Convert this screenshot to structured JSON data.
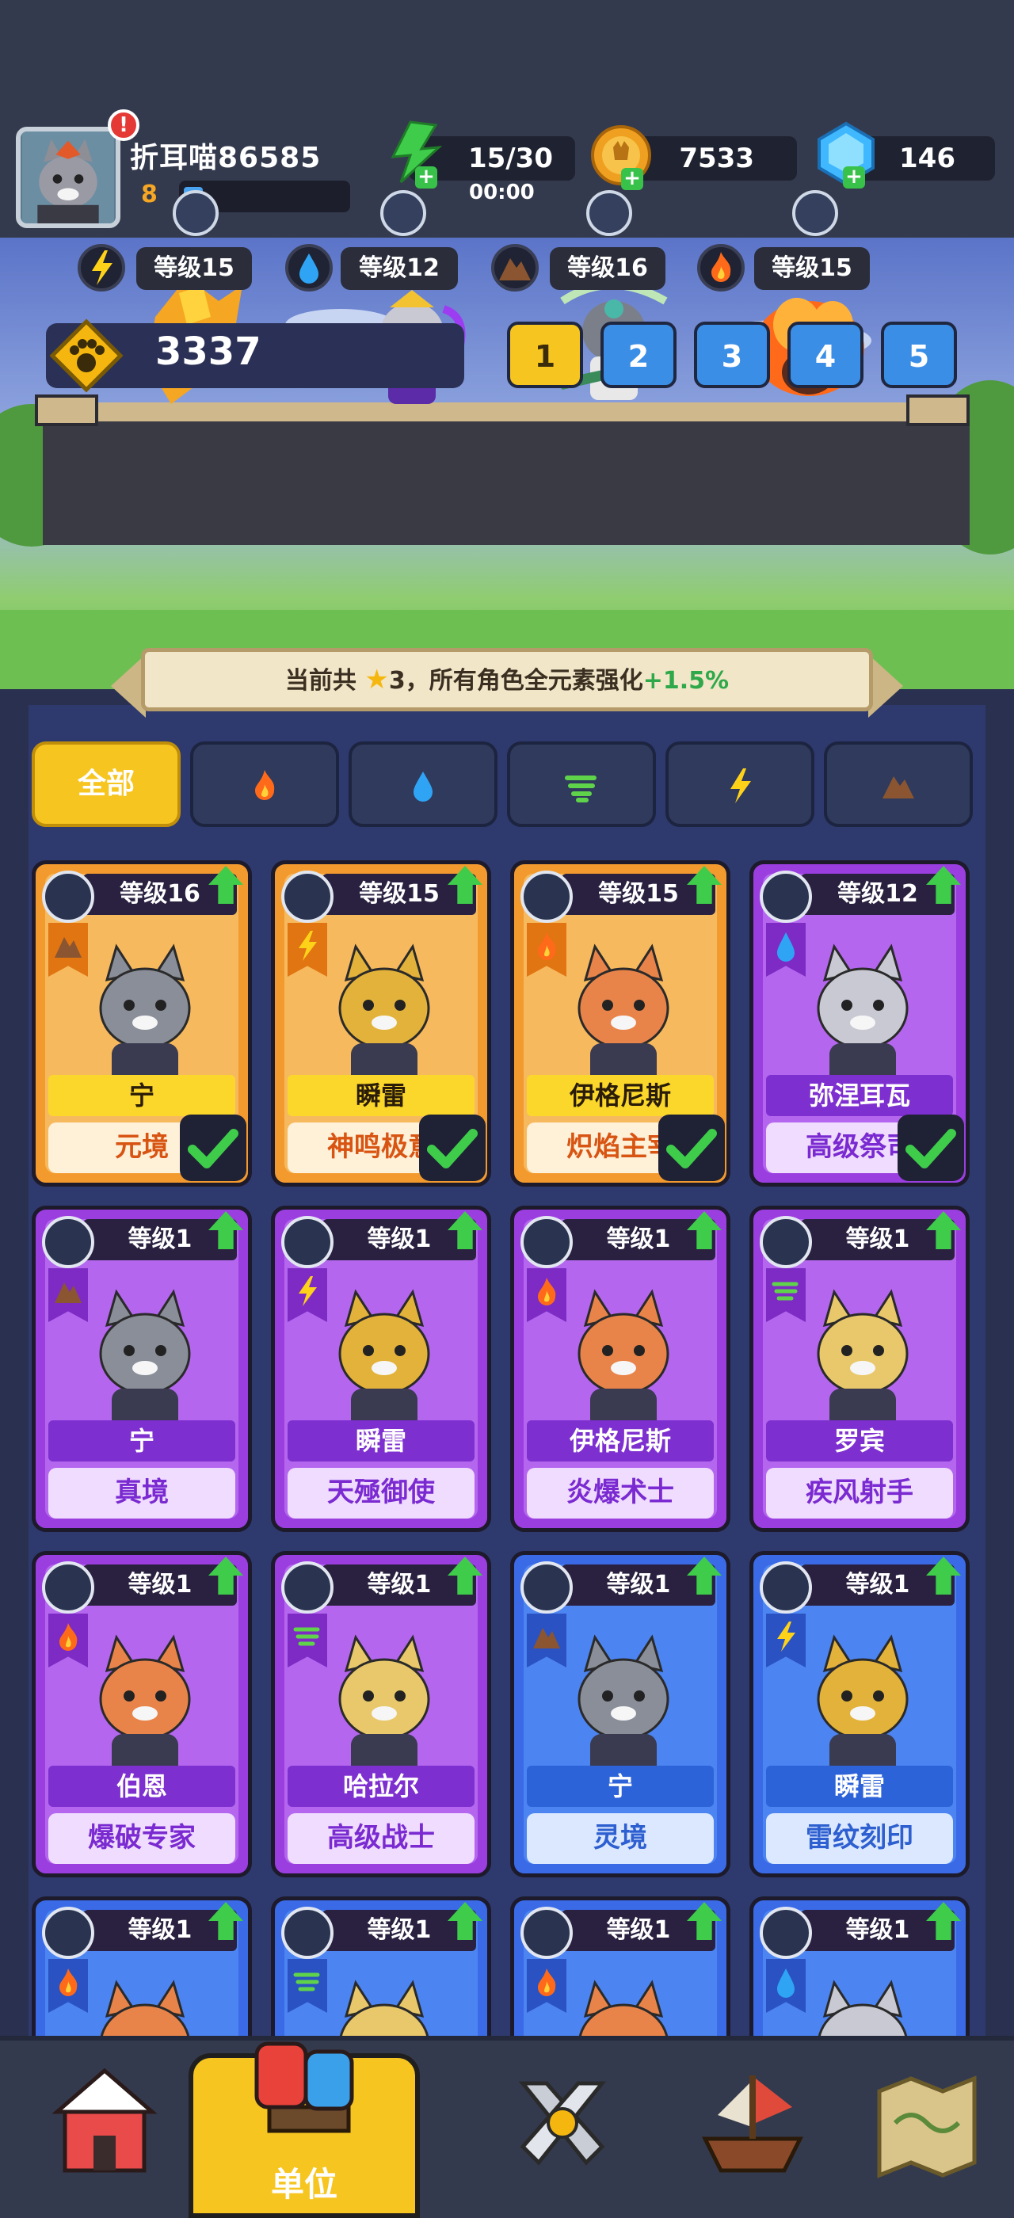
{
  "player": {
    "name": "折耳喵86585",
    "level": "8",
    "xp_fraction": 0.12,
    "alert": "!"
  },
  "resources": {
    "energy": "15/30",
    "energy_timer": "00:00",
    "coins": "7533",
    "gems": "146"
  },
  "team": {
    "heroes": [
      {
        "element": "lightning-icon",
        "level": "等级15"
      },
      {
        "element": "water-icon",
        "level": "等级12"
      },
      {
        "element": "earth-icon",
        "level": "等级16"
      },
      {
        "element": "fire-icon",
        "level": "等级15"
      }
    ],
    "power": "3337",
    "tabs": [
      "1",
      "2",
      "3",
      "4",
      "5"
    ],
    "active_tab": "1"
  },
  "banner": {
    "prefix": "当前共",
    "stars": "3",
    "suffix": "，所有角色全元素强化",
    "bonus": "+1.5%"
  },
  "filters": {
    "all_label": "全部",
    "icons": [
      "fire-icon",
      "water-icon",
      "wind-icon",
      "lightning-icon",
      "earth-icon"
    ]
  },
  "cards": [
    {
      "rarity": "orange",
      "element": "earth",
      "level": "等级16",
      "name": "宁",
      "title": "元境",
      "owned": true
    },
    {
      "rarity": "orange",
      "element": "lightning",
      "level": "等级15",
      "name": "瞬雷",
      "title": "神鸣极意",
      "owned": true
    },
    {
      "rarity": "orange",
      "element": "fire",
      "level": "等级15",
      "name": "伊格尼斯",
      "title": "炽焰主宰",
      "owned": true
    },
    {
      "rarity": "purple",
      "element": "water",
      "level": "等级12",
      "name": "弥涅耳瓦",
      "title": "高级祭司",
      "owned": true
    },
    {
      "rarity": "purple",
      "element": "earth",
      "level": "等级1",
      "name": "宁",
      "title": "真境",
      "owned": false
    },
    {
      "rarity": "purple",
      "element": "lightning",
      "level": "等级1",
      "name": "瞬雷",
      "title": "天殛御使",
      "owned": false
    },
    {
      "rarity": "purple",
      "element": "fire",
      "level": "等级1",
      "name": "伊格尼斯",
      "title": "炎爆术士",
      "owned": false
    },
    {
      "rarity": "purple",
      "element": "wind",
      "level": "等级1",
      "name": "罗宾",
      "title": "疾风射手",
      "owned": false
    },
    {
      "rarity": "purple",
      "element": "fire",
      "level": "等级1",
      "name": "伯恩",
      "title": "爆破专家",
      "owned": false
    },
    {
      "rarity": "purple",
      "element": "wind",
      "level": "等级1",
      "name": "哈拉尔",
      "title": "高级战士",
      "owned": false
    },
    {
      "rarity": "blue",
      "element": "earth",
      "level": "等级1",
      "name": "宁",
      "title": "灵境",
      "owned": false
    },
    {
      "rarity": "blue",
      "element": "lightning",
      "level": "等级1",
      "name": "瞬雷",
      "title": "雷纹刻印",
      "owned": false
    },
    {
      "rarity": "blue",
      "element": "fire",
      "level": "等级1",
      "name": "",
      "title": "",
      "owned": false
    },
    {
      "rarity": "blue",
      "element": "wind",
      "level": "等级1",
      "name": "",
      "title": "",
      "owned": false
    },
    {
      "rarity": "blue",
      "element": "fire",
      "level": "等级1",
      "name": "",
      "title": "",
      "owned": false
    },
    {
      "rarity": "blue",
      "element": "water",
      "level": "等级1",
      "name": "",
      "title": "",
      "owned": false
    }
  ],
  "nav": {
    "items": [
      "home-icon",
      "units-icon",
      "battle-icon",
      "ship-icon",
      "map-icon"
    ],
    "active_label": "单位"
  },
  "colors": {
    "energy": "#3ecc4a",
    "coin": "#f0a020",
    "gem": "#3fb8ff",
    "active_yellow": "#f7c520",
    "fire": "#ff6a1a",
    "water": "#2fa4f5",
    "wind": "#5fd44a",
    "lightning": "#ffd21a",
    "earth": "#7a4a2a"
  }
}
